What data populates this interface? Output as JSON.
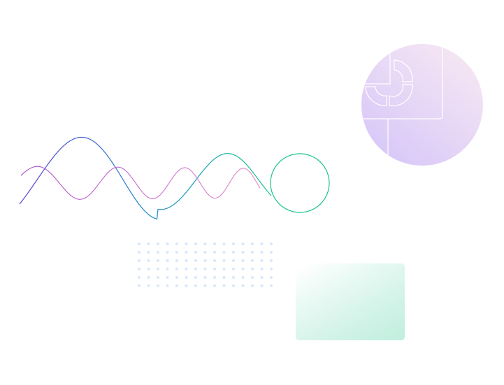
{
  "colors": {
    "background": "#ffffff",
    "wave_start": "#5b3fd6",
    "wave_mid": "#1a8fc4",
    "wave_end": "#19c48a",
    "pink_wave_start": "#a94fd1",
    "pink_wave_end": "#e58ac6",
    "circle_start": "#d9c9f8",
    "circle_end": "#f5e6f4",
    "dots": "#d7e8fb",
    "card_start": "#ffffff",
    "card_end": "#b7ecd9"
  },
  "icons": {
    "wave_primary": "sine-wave-line",
    "wave_secondary": "sine-wave-line",
    "ring": "circle-outline",
    "dots": "dot-grid",
    "circle": "donut-chart-circle",
    "card": "gradient-card"
  }
}
